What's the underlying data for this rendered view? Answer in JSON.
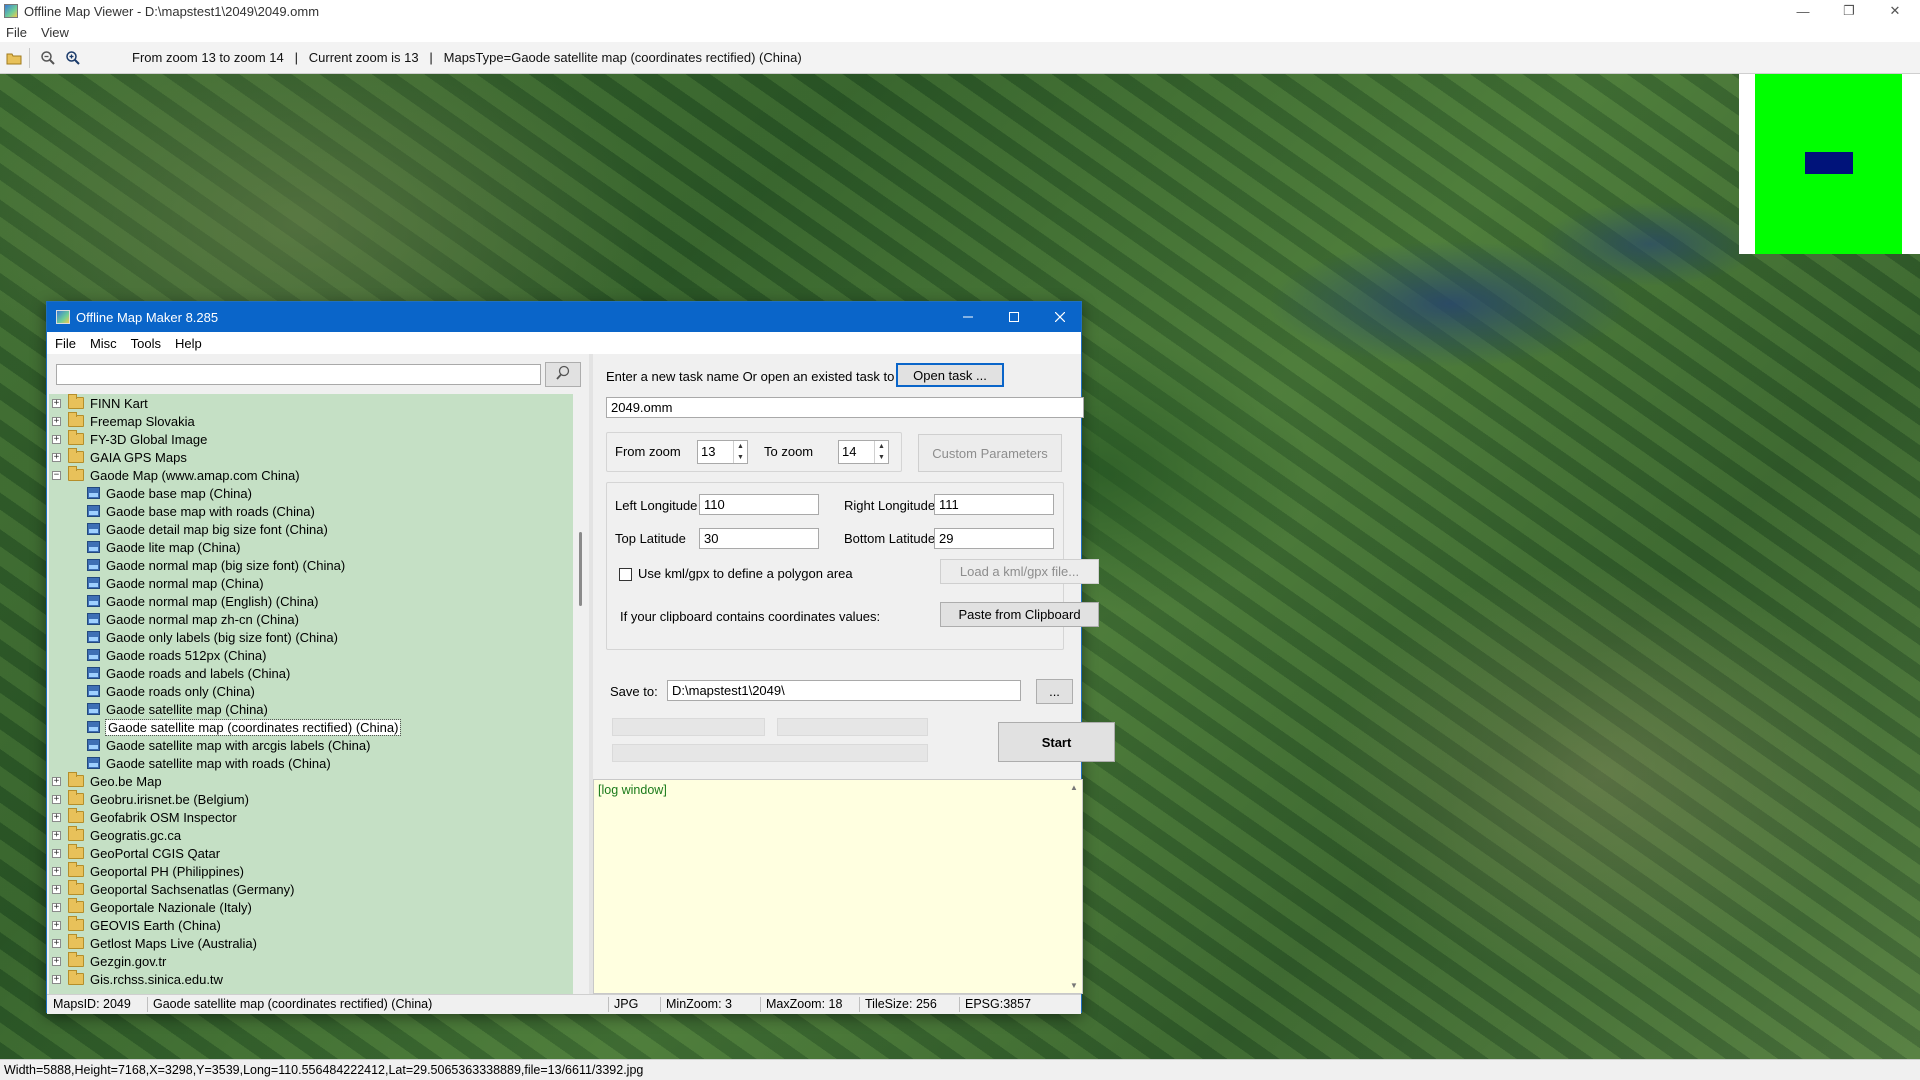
{
  "window": {
    "title": "Offline Map Viewer - D:\\mapstest1\\2049\\2049.omm",
    "controls": {
      "minimize": "—",
      "restore": "❐",
      "close": "✕"
    }
  },
  "menubar": [
    "File",
    "View"
  ],
  "toolbar": {
    "icons": [
      "folder-open-icon",
      "zoom-out-icon",
      "zoom-in-icon"
    ],
    "info": "From zoom 13 to zoom 14   |   Current zoom is 13   |   MapsType=Gaode satellite map (coordinates rectified) (China)"
  },
  "statusbar": "Width=5888,Height=7168,X=3298,Y=3539,Long=110.556484222412,Lat=29.5065363338889,file=13/6611/3392.jpg",
  "colors": {
    "minimap_bg": "#00ff00",
    "minimap_view": "#00137a",
    "dialog_title": "#0a65c9",
    "tree_bg": "#c5e0c5",
    "log_bg": "#ffffe0"
  },
  "dialog": {
    "title": "Offline Map Maker 8.285",
    "menu": [
      "File",
      "Misc",
      "Tools",
      "Help"
    ],
    "search": {
      "value": ""
    },
    "tree": [
      {
        "label": "FINN Kart",
        "level": 0,
        "type": "folder",
        "expander": "+"
      },
      {
        "label": "Freemap Slovakia",
        "level": 0,
        "type": "folder",
        "expander": "+"
      },
      {
        "label": "FY-3D Global Image",
        "level": 0,
        "type": "folder",
        "expander": "+"
      },
      {
        "label": "GAIA GPS Maps",
        "level": 0,
        "type": "folder",
        "expander": "+"
      },
      {
        "label": "Gaode Map (www.amap.com China)",
        "level": 0,
        "type": "folder",
        "expander": "−"
      },
      {
        "label": "Gaode base map (China)",
        "level": 1,
        "type": "map"
      },
      {
        "label": "Gaode base map with roads (China)",
        "level": 1,
        "type": "map"
      },
      {
        "label": "Gaode detail map big size font (China)",
        "level": 1,
        "type": "map"
      },
      {
        "label": "Gaode lite map (China)",
        "level": 1,
        "type": "map"
      },
      {
        "label": "Gaode normal map (big size font) (China)",
        "level": 1,
        "type": "map"
      },
      {
        "label": "Gaode normal map (China)",
        "level": 1,
        "type": "map"
      },
      {
        "label": "Gaode normal map (English) (China)",
        "level": 1,
        "type": "map"
      },
      {
        "label": "Gaode normal map zh-cn (China)",
        "level": 1,
        "type": "map"
      },
      {
        "label": "Gaode only labels (big size font) (China)",
        "level": 1,
        "type": "map"
      },
      {
        "label": "Gaode roads 512px (China)",
        "level": 1,
        "type": "map"
      },
      {
        "label": "Gaode roads and labels (China)",
        "level": 1,
        "type": "map"
      },
      {
        "label": "Gaode roads only (China)",
        "level": 1,
        "type": "map"
      },
      {
        "label": "Gaode satellite map (China)",
        "level": 1,
        "type": "map"
      },
      {
        "label": "Gaode satellite map (coordinates rectified) (China)",
        "level": 1,
        "type": "map",
        "selected": true
      },
      {
        "label": "Gaode satellite map with arcgis labels (China)",
        "level": 1,
        "type": "map"
      },
      {
        "label": "Gaode satellite map with roads (China)",
        "level": 1,
        "type": "map"
      },
      {
        "label": "Geo.be Map",
        "level": 0,
        "type": "folder",
        "expander": "+"
      },
      {
        "label": "Geobru.irisnet.be (Belgium)",
        "level": 0,
        "type": "folder",
        "expander": "+"
      },
      {
        "label": "Geofabrik OSM Inspector",
        "level": 0,
        "type": "folder",
        "expander": "+"
      },
      {
        "label": "Geogratis.gc.ca",
        "level": 0,
        "type": "folder",
        "expander": "+"
      },
      {
        "label": "GeoPortal CGIS Qatar",
        "level": 0,
        "type": "folder",
        "expander": "+"
      },
      {
        "label": "Geoportal PH (Philippines)",
        "level": 0,
        "type": "folder",
        "expander": "+"
      },
      {
        "label": "Geoportal Sachsenatlas (Germany)",
        "level": 0,
        "type": "folder",
        "expander": "+"
      },
      {
        "label": "Geoportale Nazionale (Italy)",
        "level": 0,
        "type": "folder",
        "expander": "+"
      },
      {
        "label": "GEOVIS Earth (China)",
        "level": 0,
        "type": "folder",
        "expander": "+"
      },
      {
        "label": "Getlost Maps Live (Australia)",
        "level": 0,
        "type": "folder",
        "expander": "+"
      },
      {
        "label": "Gezgin.gov.tr",
        "level": 0,
        "type": "folder",
        "expander": "+"
      },
      {
        "label": "Gis.rchss.sinica.edu.tw",
        "level": 0,
        "type": "folder",
        "expander": "+"
      }
    ],
    "task_prompt": "Enter a new task name Or open an existed task to continue:",
    "open_task_label": "Open task ...",
    "task_name": "2049.omm",
    "from_zoom_label": "From zoom",
    "from_zoom": "13",
    "to_zoom_label": "To zoom",
    "to_zoom": "14",
    "custom_params_label": "Custom Parameters",
    "left_longitude_label": "Left Longitude",
    "left_longitude": "110",
    "right_longitude_label": "Right Longitude",
    "right_longitude": "111",
    "top_latitude_label": "Top Latitude",
    "top_latitude": "30",
    "bottom_latitude_label": "Bottom Latitude",
    "bottom_latitude": "29",
    "kml_checkbox_label": "Use kml/gpx to define a polygon area",
    "load_kml_label": "Load a kml/gpx file...",
    "clipboard_prompt": "If your clipboard contains coordinates values:",
    "paste_label": "Paste from Clipboard",
    "save_to_label": "Save to:",
    "save_to": "D:\\mapstest1\\2049\\",
    "browse_label": "...",
    "start_label": "Start",
    "log_text": "[log window]",
    "status": {
      "maps_id": "MapsID: 2049",
      "map_name": "Gaode satellite map (coordinates rectified) (China)",
      "format": "JPG",
      "min_zoom": "MinZoom: 3",
      "max_zoom": "MaxZoom: 18",
      "tile_size": "TileSize: 256",
      "epsg": "EPSG:3857"
    }
  }
}
